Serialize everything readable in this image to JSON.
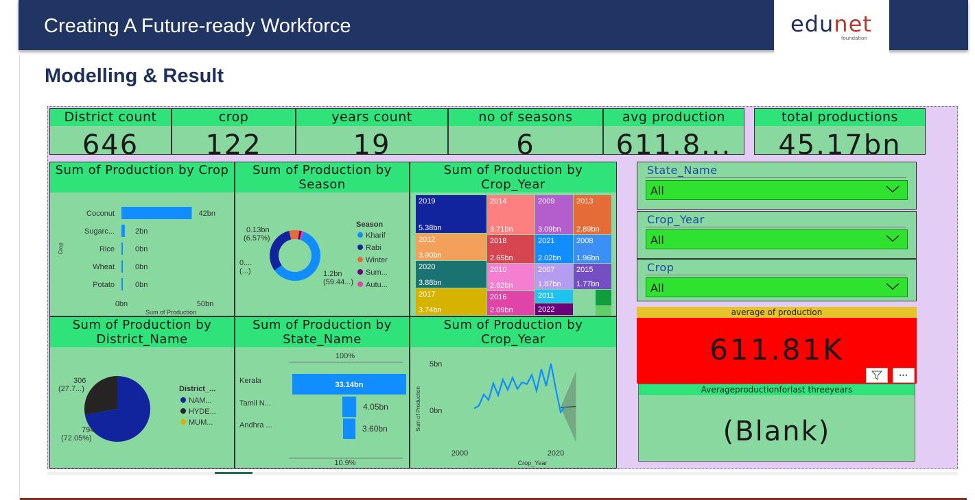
{
  "slide": {
    "header_title": "Creating A Future-ready Workforce",
    "logo_text": "edunet",
    "logo_sub": "foundation",
    "title": "Modelling & Result"
  },
  "kpis": [
    {
      "label": "District count",
      "value": "646"
    },
    {
      "label": "crop",
      "value": "122"
    },
    {
      "label": "years count",
      "value": "19"
    },
    {
      "label": "no of seasons",
      "value": "6"
    },
    {
      "label": "avg production",
      "value": "611.8..."
    },
    {
      "label": "total productions",
      "value": "45.17bn"
    }
  ],
  "panels": {
    "crop": {
      "title": "Sum of Production by Crop"
    },
    "season": {
      "title": "Sum of Production by Season"
    },
    "year_tree": {
      "title": "Sum of Production by Crop_Year"
    },
    "district": {
      "title": "Sum of Production by District_Name"
    },
    "state": {
      "title": "Sum of Production by State_Name"
    },
    "year_line": {
      "title": "Sum of Production by Crop_Year"
    }
  },
  "slicers": [
    {
      "label": "State_Name",
      "value": "All"
    },
    {
      "label": "Crop_Year",
      "value": "All"
    },
    {
      "label": "Crop",
      "value": "All"
    }
  ],
  "cards": {
    "avg": {
      "label": "average of production",
      "value": "611.81K"
    },
    "last3": {
      "label": "Averageproductionforlast threeyears",
      "value": "(Blank)"
    }
  },
  "icons": {
    "filter": "filter-icon",
    "more": "more-options-icon",
    "chevron": "chevron-down-icon"
  },
  "colors": {
    "accent_blue": "#118dff",
    "header_green": "#2fe27a",
    "panel_green": "#88d8a0",
    "slide_navy": "#203564"
  },
  "chart_data": [
    {
      "type": "bar",
      "orientation": "horizontal",
      "title": "Sum of Production by Crop",
      "categories": [
        "Coconut",
        "Sugarc...",
        "Rice",
        "Wheat",
        "Potato"
      ],
      "values": [
        42,
        2,
        0,
        0,
        0
      ],
      "value_labels": [
        "42bn",
        "2bn",
        "0bn",
        "0bn",
        "0bn"
      ],
      "xlabel": "Sum of Production",
      "ylabel": "Crop",
      "ticks": [
        "0bn",
        "50bn"
      ],
      "xlim": [
        0,
        50
      ]
    },
    {
      "type": "pie",
      "donut": true,
      "title": "Sum of Production by Season",
      "legend_title": "Season",
      "legend": [
        "Kharif",
        "Rabi",
        "Winter",
        "Sum...",
        "Autu..."
      ],
      "legend_colors": [
        "#118dff",
        "#12239e",
        "#e66c37",
        "#6b007b",
        "#e044a7"
      ],
      "labels": [
        "0.13bn",
        "(6.57%)",
        "0....",
        "(...)",
        "1.2bn",
        "(59.44...)"
      ],
      "values": [
        59.44,
        31.2,
        6.57,
        1.6,
        1.19
      ]
    },
    {
      "type": "treemap",
      "title": "Sum of Production by Crop_Year",
      "items": [
        {
          "year": "2019",
          "value": "5.38bn",
          "color": "#12239e"
        },
        {
          "year": "2012",
          "value": "3.90bn",
          "color": "#f2a05a"
        },
        {
          "year": "2020",
          "value": "3.88bn",
          "color": "#1a7371"
        },
        {
          "year": "2017",
          "value": "3.74bn",
          "color": "#d6b300"
        },
        {
          "year": "2014",
          "value": "3.71bn",
          "color": "#fd8080"
        },
        {
          "year": "2018",
          "value": "2.65bn",
          "color": "#d64550"
        },
        {
          "year": "2010",
          "value": "2.62bn",
          "color": "#f47fd1"
        },
        {
          "year": "2016",
          "value": "2.09bn",
          "color": "#e044a7"
        },
        {
          "year": "2009",
          "value": "3.09bn",
          "color": "#b35ecc"
        },
        {
          "year": "2021",
          "value": "2.02bn",
          "color": "#118dff"
        },
        {
          "year": "2007",
          "value": "1.87bn",
          "color": "#b69cf0"
        },
        {
          "year": "2011",
          "value": "",
          "color": "#1fc2f0"
        },
        {
          "year": "2022",
          "value": "",
          "color": "#6b007b"
        },
        {
          "year": "2013",
          "value": "2.89bn",
          "color": "#e66c37"
        },
        {
          "year": "2008",
          "value": "1.96bn",
          "color": "#3b8ff5"
        },
        {
          "year": "2015",
          "value": "1.77bn",
          "color": "#744ec2"
        }
      ]
    },
    {
      "type": "pie",
      "title": "Sum of Production by District_Name",
      "legend_title": "District_...",
      "legend": [
        "NAM...",
        "HYDE...",
        "MUM..."
      ],
      "legend_colors": [
        "#12239e",
        "#252423",
        "#d6b300"
      ],
      "labels": [
        "306",
        "(27.7...)",
        "794",
        "(72.05%)"
      ],
      "values": [
        794,
        306
      ]
    },
    {
      "type": "bar",
      "subtype": "funnel",
      "title": "Sum of Production by State_Name",
      "categories": [
        "Kerala",
        "Tamil N...",
        "Andhra ..."
      ],
      "values": [
        33.14,
        4.05,
        3.6
      ],
      "value_labels": [
        "33.14bn",
        "4.05bn",
        "3.60bn"
      ],
      "top_label": "100%",
      "bottom_label": "10.9%"
    },
    {
      "type": "line",
      "title": "Sum of Production by Crop_Year",
      "xlabel": "Crop_Year",
      "ylabel": "Sum of Production",
      "yticks": [
        "5bn",
        "0bn"
      ],
      "xticks": [
        "2000",
        "2020"
      ],
      "x": [
        2003,
        2004,
        2005,
        2006,
        2007,
        2008,
        2009,
        2010,
        2011,
        2012,
        2013,
        2014,
        2015,
        2016,
        2017,
        2018,
        2019,
        2020,
        2021,
        2022
      ],
      "y": [
        0.2,
        0.5,
        1.7,
        1.1,
        2.9,
        1.6,
        3.3,
        2.2,
        3.5,
        2.3,
        3.0,
        2.8,
        3.8,
        2.1,
        4.4,
        2.6,
        5.0,
        2.3,
        -0.2,
        0.4
      ]
    }
  ]
}
